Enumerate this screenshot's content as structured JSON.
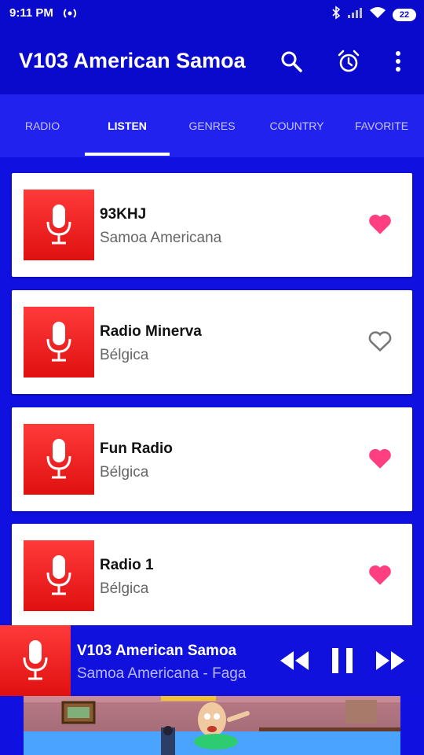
{
  "status": {
    "time": "9:11 PM",
    "battery": "22"
  },
  "appbar": {
    "title": "V103 American Samoa"
  },
  "tabs": [
    {
      "label": "RADIO",
      "active": false
    },
    {
      "label": "LISTEN",
      "active": true
    },
    {
      "label": "GENRES",
      "active": false
    },
    {
      "label": "COUNTRY",
      "active": false
    },
    {
      "label": "FAVORITE",
      "active": false
    }
  ],
  "stations": [
    {
      "name": "93KHJ",
      "location": "Samoa Americana",
      "favorite": true
    },
    {
      "name": "Radio Minerva",
      "location": "Bélgica",
      "favorite": false
    },
    {
      "name": "Fun Radio",
      "location": "Bélgica",
      "favorite": true
    },
    {
      "name": "Radio 1",
      "location": "Bélgica",
      "favorite": true
    }
  ],
  "player": {
    "name": "V103 American Samoa",
    "subtitle": "Samoa Americana - Faga"
  },
  "icons": {
    "thumb": "microphone-icon",
    "fav_on": "heart-filled-icon",
    "fav_off": "heart-outline-icon"
  },
  "colors": {
    "primary": "#0a0acc",
    "tabs": "#2222ee",
    "accent_heart": "#ff3f7f",
    "thumb": "#ff2a2a"
  }
}
